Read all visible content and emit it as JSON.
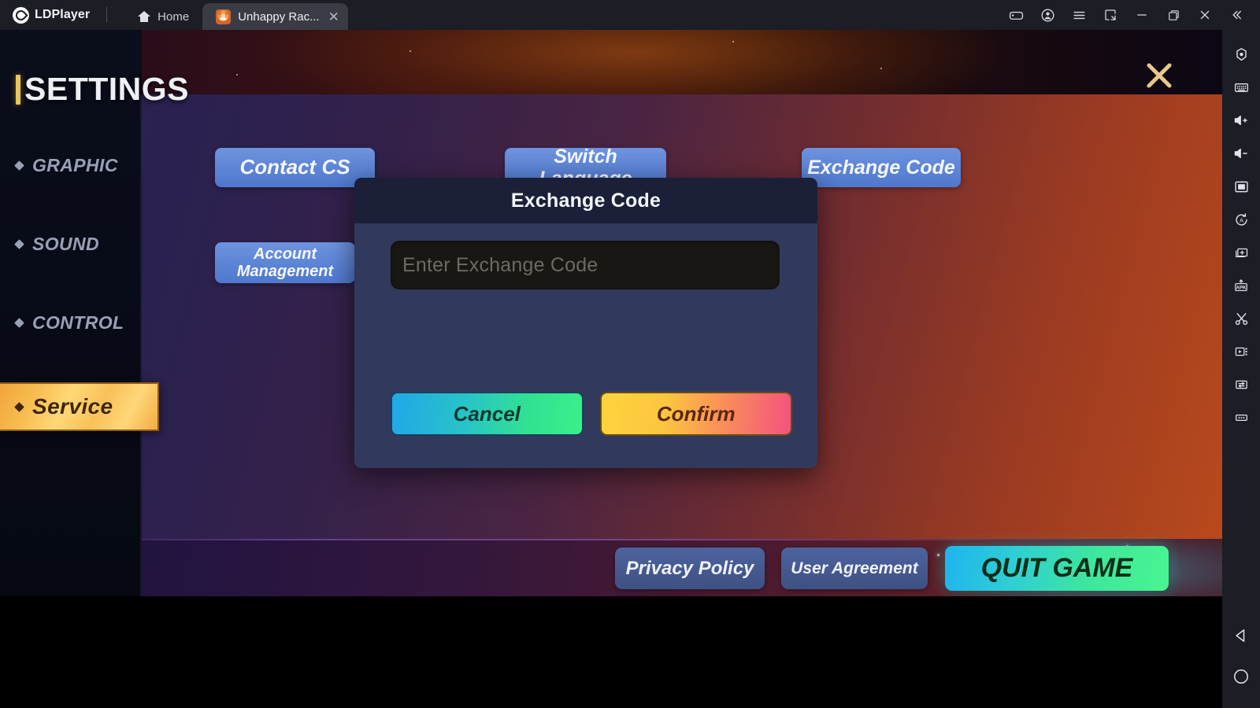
{
  "emulator": {
    "brand": "LDPlayer",
    "tabs": [
      {
        "label": "Home",
        "icon": "home-icon",
        "active": false
      },
      {
        "label": "Unhappy Rac...",
        "icon": "game-favicon",
        "active": true,
        "close": "✕"
      }
    ],
    "window_controls": [
      {
        "name": "gamepad-icon",
        "title": "Keyboard mapping"
      },
      {
        "name": "account-icon",
        "title": "Account"
      },
      {
        "name": "menu-icon",
        "title": "Menu"
      },
      {
        "name": "restore-down-icon",
        "title": "Restore down"
      },
      {
        "name": "minimize-icon",
        "title": "Minimize"
      },
      {
        "name": "maximize-icon",
        "title": "Maximize"
      },
      {
        "name": "close-icon",
        "title": "Close"
      },
      {
        "name": "collapse-icon",
        "title": "Collapse toolbar"
      }
    ],
    "sidebar_tools": [
      "settings-icon",
      "keyboard-icon",
      "volume-up-icon",
      "volume-down-icon",
      "fullscreen-icon",
      "rotate-screen-icon",
      "multi-instance-icon",
      "apk-install-icon",
      "scissors-icon",
      "video-record-icon",
      "file-transfer-icon",
      "more-options-icon"
    ],
    "android_nav": [
      "back-icon",
      "home-circle-icon"
    ]
  },
  "game": {
    "page_title": "SETTINGS",
    "close_button": "✕",
    "nav": [
      {
        "label": "GRAPHIC",
        "active": false
      },
      {
        "label": "SOUND",
        "active": false
      },
      {
        "label": "CONTROL",
        "active": false
      },
      {
        "label": "Service",
        "active": true
      }
    ],
    "service_buttons": [
      {
        "label": "Contact CS"
      },
      {
        "label": "Switch Language"
      },
      {
        "label": "Exchange Code"
      },
      {
        "label": "Account\nManagement"
      }
    ],
    "bottom_buttons": [
      {
        "label": "Privacy Policy"
      },
      {
        "label": "User Agreement"
      },
      {
        "label": "QUIT GAME"
      }
    ],
    "dialog": {
      "title": "Exchange Code",
      "input_placeholder": "Enter Exchange Code",
      "input_value": "",
      "cancel_label": "Cancel",
      "confirm_label": "Confirm"
    }
  },
  "colors": {
    "accent_gold": "#f7bc50",
    "button_blue": "#5d85d6",
    "cancel_gradient_start": "#21a7e8",
    "cancel_gradient_end": "#39f08a",
    "confirm_gradient_start": "#fdd43d",
    "confirm_gradient_end": "#f4527e",
    "quit_gradient_start": "#1fb4ef",
    "quit_gradient_end": "#49f590",
    "titlebar_bg": "#1c1d25"
  }
}
